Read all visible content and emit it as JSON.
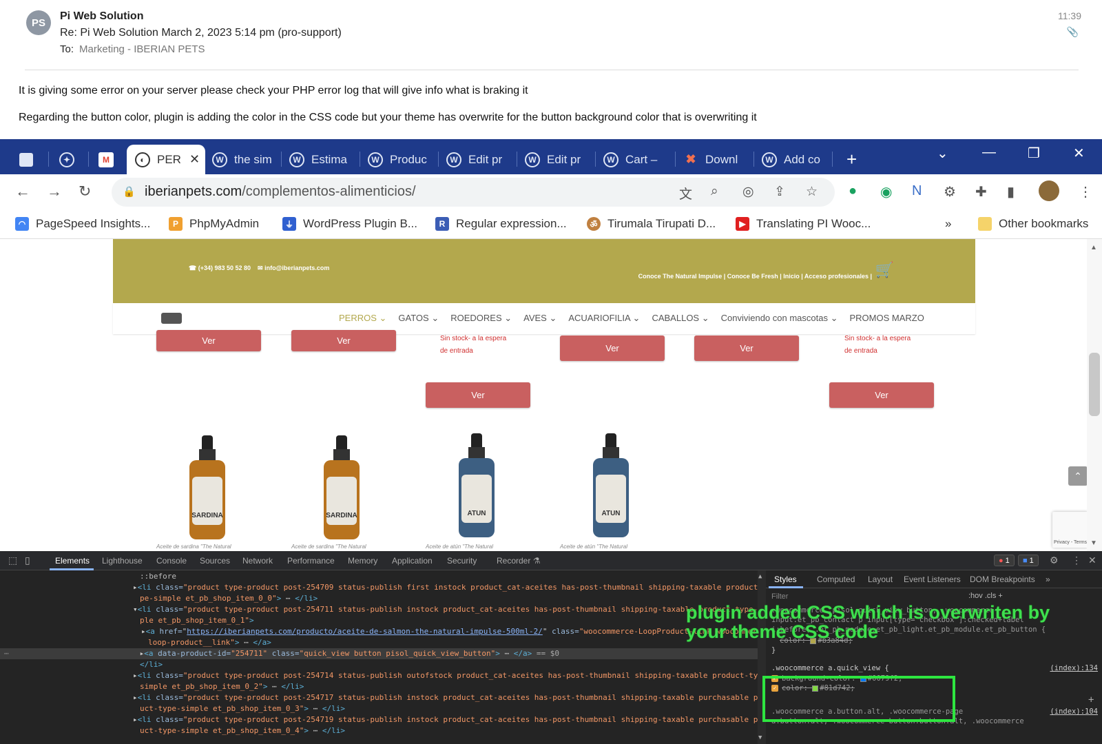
{
  "email": {
    "avatar_initials": "PS",
    "sender": "Pi Web Solution",
    "subject": "Re: Pi Web Solution March 2, 2023 5:14 pm (pro-support)",
    "to_label": "To:",
    "to_value": "Marketing - IBERIAN PETS",
    "time": "11:39",
    "body": [
      "It is giving some error on your server please check your PHP error log that will give info what is braking it",
      "Regarding the button color, plugin is adding the color in the CSS code but your theme has overwrite for the button background color that is overwriting it"
    ]
  },
  "browser": {
    "tabs": [
      {
        "label": "PER",
        "icon": "site-favicon",
        "active": true
      },
      {
        "label": "the sim",
        "icon": "wordpress-icon"
      },
      {
        "label": "Estima",
        "icon": "wordpress-icon"
      },
      {
        "label": "Produc",
        "icon": "wordpress-icon"
      },
      {
        "label": "Edit pr",
        "icon": "wordpress-icon"
      },
      {
        "label": "Edit pr",
        "icon": "wordpress-icon"
      },
      {
        "label": "Cart –",
        "icon": "wordpress-icon"
      },
      {
        "label": "Downl",
        "icon": "joomla-icon"
      },
      {
        "label": "Add co",
        "icon": "wordpress-icon"
      }
    ],
    "new_tab": "+",
    "url_domain": "iberianpets.com",
    "url_path": "/complementos-alimenticios/",
    "bookmarks": [
      {
        "label": "PageSpeed Insights...",
        "icon": "pagespeed-icon",
        "color": "#4285f4"
      },
      {
        "label": "PhpMyAdmin",
        "icon": "phpmyadmin-icon",
        "color": "#f0a030"
      },
      {
        "label": "WordPress Plugin B...",
        "icon": "plugin-icon",
        "color": "#3060d0"
      },
      {
        "label": "Regular expression...",
        "icon": "regex-icon",
        "color": "#3b5db5"
      },
      {
        "label": "Tirumala Tirupati D...",
        "icon": "temple-icon",
        "color": "#c08040"
      },
      {
        "label": "Translating PI Wooc...",
        "icon": "youtube-icon",
        "color": "#e02020"
      }
    ],
    "bookmarks_more": "»",
    "other_bookmarks": "Other bookmarks"
  },
  "site": {
    "phone": "(+34) 983 50 52 80",
    "email": "info@iberianpets.com",
    "top_links": "Conoce The Natural Impulse |   Conoce Be Fresh |   Inicio |   Acceso profesionales |",
    "menu": [
      "PERROS ⌄",
      "GATOS ⌄",
      "ROEDORES ⌄",
      "AVES ⌄",
      "ACUARIOFILIA ⌄",
      "CABALLOS ⌄",
      "Conviviendo con mascotas ⌄",
      "PROMOS MARZO"
    ],
    "ver_label": "Ver",
    "no_stock_line1": "Sin stock- a la espera",
    "no_stock_line2": "de entrada",
    "products": [
      {
        "label_text": "SARDINA",
        "name": "Aceite de sardina \"The Natural"
      },
      {
        "label_text": "SARDINA",
        "name": "Aceite de sardina \"The Natural"
      },
      {
        "label_text": "ATUN",
        "name": "Aceite de atún \"The Natural"
      },
      {
        "label_text": "ATUN",
        "name": "Aceite de atún \"The Natural"
      }
    ],
    "recaptcha_text": "Privacy - Terms"
  },
  "devtools": {
    "tabs": [
      "Elements",
      "Lighthouse",
      "Console",
      "Sources",
      "Network",
      "Performance",
      "Memory",
      "Application",
      "Security",
      "Recorder ⚗"
    ],
    "errors_badge": "1",
    "messages_badge": "1",
    "dom_lines": {
      "before": "::before",
      "l1a": "\"product type-product post-254709 status-publish first instock product_cat-aceites has-post-thumbnail shipping-taxable product-ty",
      "l1b": "pe-simple et_pb_shop_item_0_0\"",
      "l2a": "\"product type-product post-254711 status-publish instock product_cat-aceites has-post-thumbnail shipping-taxable product-type-sim",
      "l2b": "ple et_pb_shop_item_0_1\"",
      "l3_href": "https://iberianpets.com/producto/aceite-de-salmon-the-natural-impulse-500ml-2/",
      "l3_class": "\"woocommerce-LoopProduct-link woocommerce-",
      "l3b": "loop-product__link\"",
      "sel_id": "\"254711\"",
      "sel_class": "\"quick_view button pisol_quick_view_button\"",
      "sel_suffix": "== $0",
      "l5a": "\"product type-product post-254714 status-publish outofstock product_cat-aceites has-post-thumbnail shipping-taxable product-type-",
      "l5b": "simple et_pb_shop_item_0_2\"",
      "l6a": "\"product type-product post-254717 status-publish instock product_cat-aceites has-post-thumbnail shipping-taxable purchasable prod",
      "l6b": "uct-type-simple et_pb_shop_item_0_3\"",
      "l7a": "\"product type-product post-254719 status-publish instock product_cat-aceites has-post-thumbnail shipping-taxable purchasable prod",
      "l7b": "uct-type-simple et_pb_shop_item_0_4\""
    },
    "styles_tabs": [
      "Styles",
      "Computed",
      "Layout",
      "Event Listeners",
      "DOM Breakpoints",
      "»"
    ],
    "filter_placeholder": "Filter",
    "hov_cls": ":hov  .cls  +",
    "rule1_sel": ".woocommerce .pisol_quick_view_button, .woocommerce-",
    "rule1_sel2": "input.et_pb_contact p input[type=\"checkbox\"]:checked+label",
    "rule1_sel3": "i:before, .et_pb_module.et_pb_light.et_pb_module.et_pb_button {",
    "rule1_prop": "color:",
    "rule1_val": "#b3a84d;",
    "rule2_sel": ".woocommerce a.quick_view {",
    "rule2_src": "(index):134",
    "rule2_p1": "background-color:",
    "rule2_v1": "#0079f2;",
    "rule2_p2": "color:",
    "rule2_v2": "#81d742;",
    "rule3_sel": ".woocommerce a.button.alt, .woocommerce-page",
    "rule3_sel2": "a.button.alt, .woocommerce button.button.alt, .woocommerce",
    "rule3_src": "(index):104",
    "annotation": "plugin added CSS which is overwriten by your theme CSS code"
  }
}
